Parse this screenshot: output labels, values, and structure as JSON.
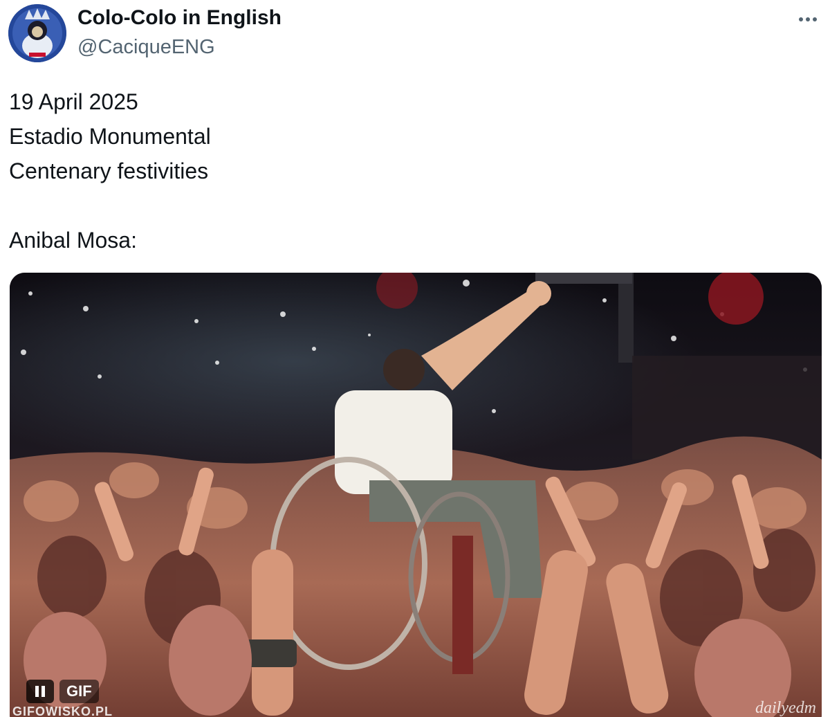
{
  "author": {
    "display_name": "Colo-Colo in English",
    "handle": "@CaciqueENG",
    "avatar_icon": "club-mascot-avatar-icon"
  },
  "menu": {
    "more_icon": "more-horizontal-icon"
  },
  "tweet": {
    "lines": [
      "19 April 2025",
      "Estadio Monumental",
      "Centenary festivities",
      "",
      "Anibal Mosa:"
    ]
  },
  "media": {
    "type": "GIF",
    "badge_label": "GIF",
    "pause_icon": "pause-icon",
    "watermark_left": "GIFOWISKO.PL",
    "watermark_right": "dailyedm"
  },
  "colors": {
    "text_primary": "#0f1419",
    "text_secondary": "#536471",
    "background": "#ffffff"
  }
}
